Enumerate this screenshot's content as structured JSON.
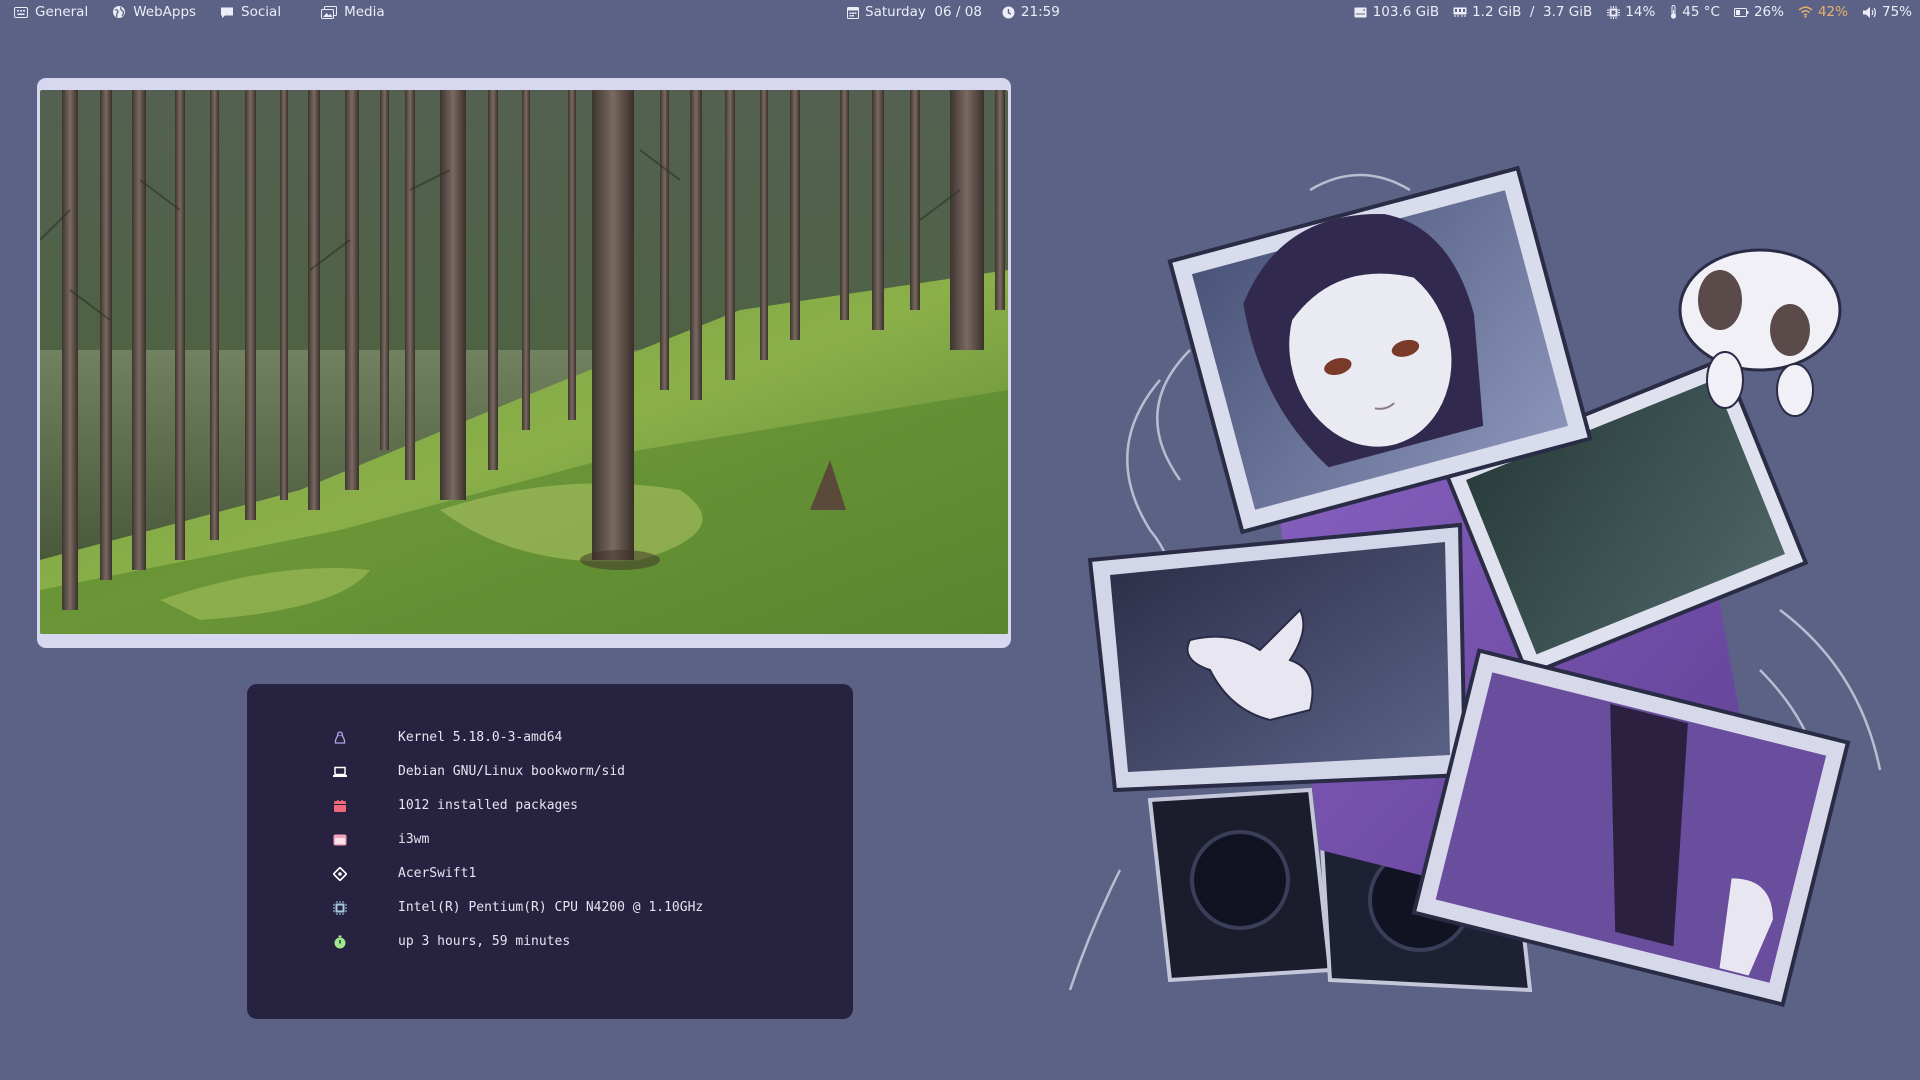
{
  "topbar": {
    "workspaces": [
      {
        "label": "General",
        "icon": "keyboard-icon"
      },
      {
        "label": "WebApps",
        "icon": "globe-icon"
      },
      {
        "label": "Social",
        "icon": "chat-icon"
      },
      {
        "label": "Media",
        "icon": "images-icon"
      }
    ],
    "date": "Saturday  06 / 08",
    "time": "21:59",
    "disk": "103.6 GiB",
    "memory": "1.2 GiB  /  3.7 GiB",
    "cpu": "14%",
    "temperature": "45 °C",
    "battery": "26%",
    "wifi": "42%",
    "volume": "75%",
    "colors": {
      "background": "#5b6286",
      "text": "#ecedf6",
      "warning": "#e8b06f"
    }
  },
  "sysinfo": {
    "rows": [
      {
        "icon": "linux-icon",
        "text": "Kernel 5.18.0-3-amd64",
        "color": "#a8a6e8"
      },
      {
        "icon": "laptop-icon",
        "text": "Debian GNU/Linux bookworm/sid",
        "color": "#ffffff"
      },
      {
        "icon": "package-icon",
        "text": "1012 installed packages",
        "color": "#ee6a7a"
      },
      {
        "icon": "window-icon",
        "text": "i3wm",
        "color": "#f0a4c0"
      },
      {
        "icon": "diamond-icon",
        "text": "AcerSwift1",
        "color": "#ffffff"
      },
      {
        "icon": "cpu-icon",
        "text": "Intel(R) Pentium(R) CPU N4200 @ 1.10GHz",
        "color": "#a6c8e0"
      },
      {
        "icon": "stopwatch-icon",
        "text": "up 3 hours, 59 minutes",
        "color": "#9fe88a"
      }
    ],
    "colors": {
      "panel": "#282241",
      "text": "#e6e4f0"
    }
  },
  "photo": {
    "subject": "forest-photo"
  },
  "artwork": {
    "subject": "anime-girl-monitors-artwork"
  }
}
